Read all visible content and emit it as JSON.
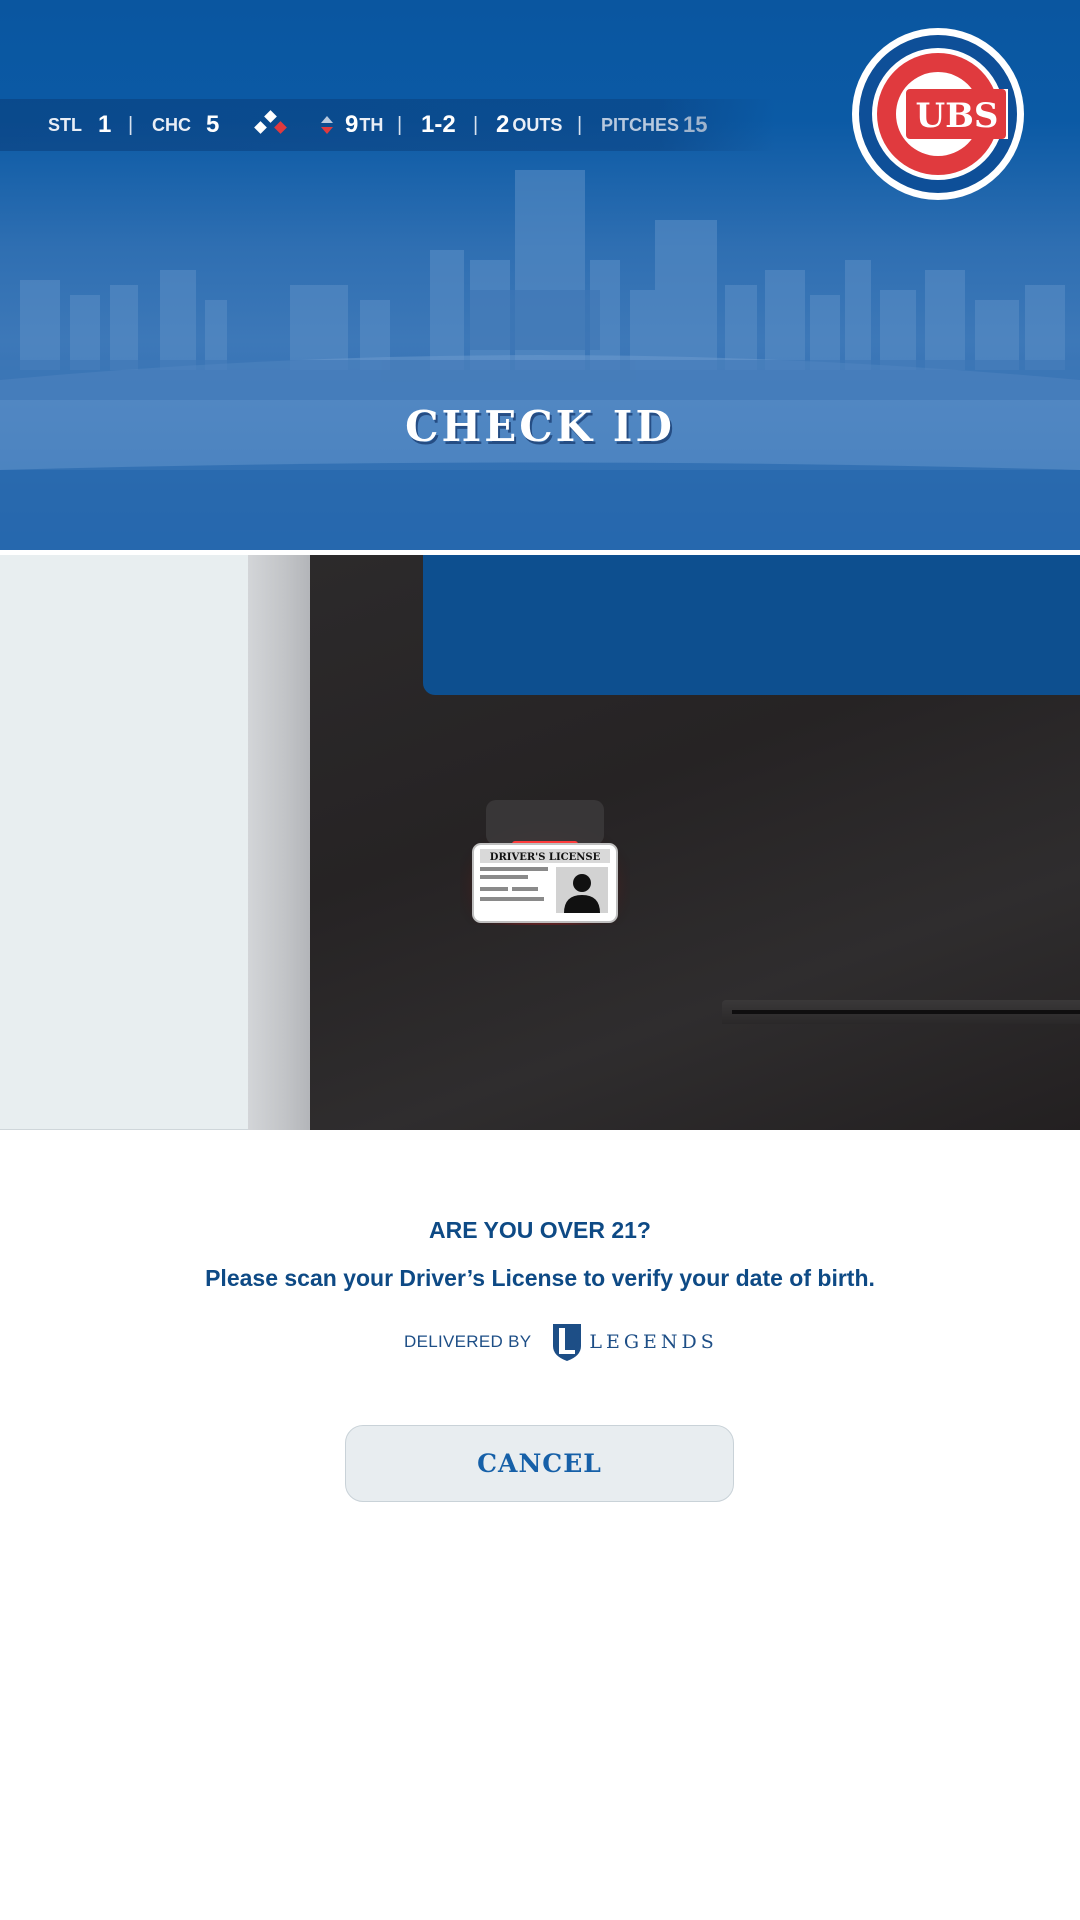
{
  "scoreboard": {
    "away_team": "STL",
    "away_score": "1",
    "home_team": "CHC",
    "home_score": "5",
    "separator": "|",
    "inning_number": "9",
    "inning_suffix": "TH",
    "count": "1-2",
    "outs_number": "2",
    "outs_label": "OUTS",
    "pitches_label": "PITCHES",
    "pitches_value": "15"
  },
  "header": {
    "title": "CHECK ID"
  },
  "team_logo": {
    "text": "UBS",
    "letter": "C"
  },
  "scanner": {
    "license_label": "DRIVER'S LICENSE"
  },
  "prompt": {
    "question": "ARE YOU OVER 21?",
    "instruction": "Please scan your Driver’s License to verify your date of birth."
  },
  "footer": {
    "delivered_by": "DELIVERED BY",
    "brand": "LEGENDS"
  },
  "actions": {
    "cancel_label": "CANCEL"
  },
  "colors": {
    "primary_blue": "#0b5aa5",
    "text_blue": "#0e4a85",
    "accent_red": "#e03a3e",
    "button_bg": "#e8edf0"
  }
}
